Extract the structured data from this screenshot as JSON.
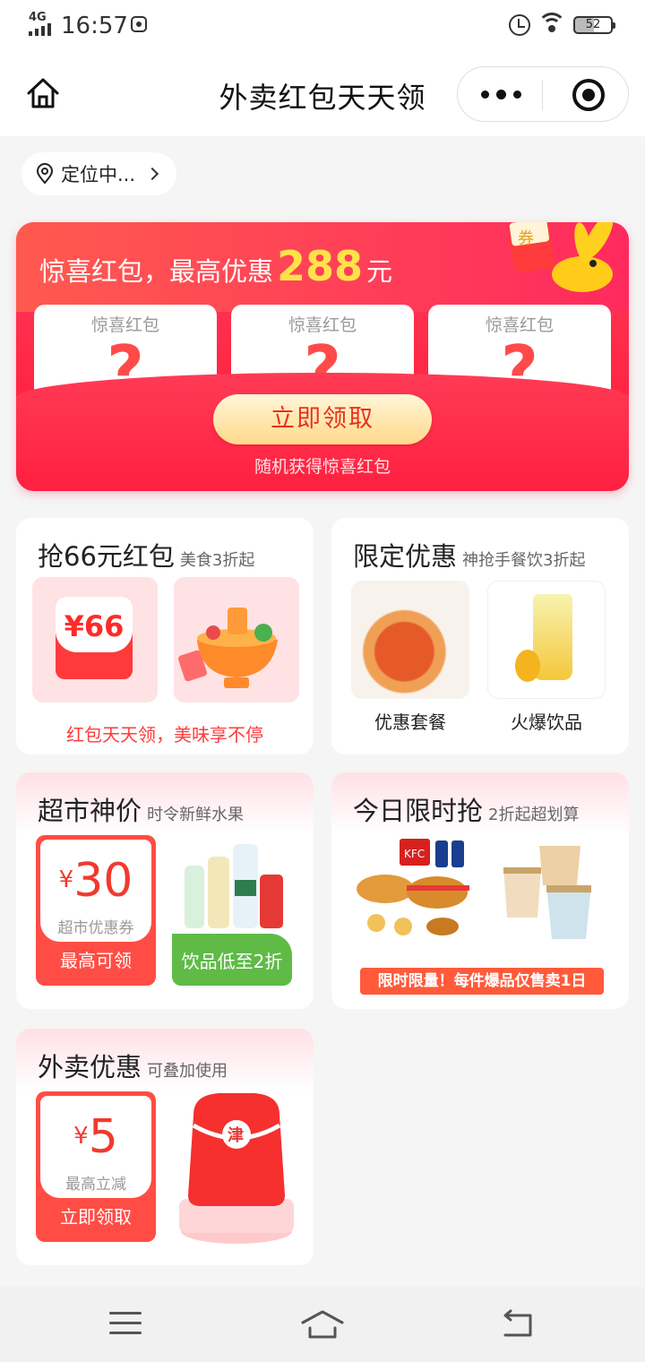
{
  "status_bar": {
    "network": "4G",
    "time": "16:57",
    "battery": "52"
  },
  "nav": {
    "title": "外卖红包天天领",
    "home_icon": "home-icon",
    "more_icon": "more-dots-icon",
    "close_icon": "miniapp-close-icon"
  },
  "location": {
    "label": "定位中..."
  },
  "banner": {
    "title_prefix": "惊喜红包，最高优惠",
    "amount": "288",
    "unit": "元",
    "cards": [
      {
        "label": "惊喜红包",
        "mark": "?"
      },
      {
        "label": "惊喜红包",
        "mark": "?"
      },
      {
        "label": "惊喜红包",
        "mark": "?"
      }
    ],
    "mascot_tag": "券",
    "button": "立即领取",
    "subtitle": "随机获得惊喜红包"
  },
  "sections": {
    "grab": {
      "title": "抢66元红包",
      "subtitle": "美食3折起",
      "badge": "¥66",
      "footer": "红包天天领，美味享不停"
    },
    "limited": {
      "title": "限定优惠",
      "subtitle": "神抢手餐饮3折起",
      "items": [
        "优惠套餐",
        "火爆饮品"
      ]
    },
    "market": {
      "title": "超市神价",
      "subtitle": "时令新鲜水果",
      "coupon_symbol": "¥",
      "coupon_value": "30",
      "coupon_tag": "超市优惠券",
      "coupon_action": "最高可领",
      "promo": "饮品低至2折"
    },
    "flash": {
      "title": "今日限时抢",
      "subtitle": "2折起超划算",
      "brand": "KFC",
      "banner": "限时限量！每件爆品仅售卖1日"
    },
    "delivery": {
      "title": "外卖优惠",
      "subtitle": "可叠加使用",
      "coupon_symbol": "¥",
      "coupon_value": "5",
      "coupon_tag": "最高立减",
      "coupon_action": "立即领取",
      "bag_mark": "津"
    }
  },
  "system_nav": {
    "menu_icon": "menu-icon",
    "home_icon": "home-outline-icon",
    "back_icon": "back-icon"
  },
  "colors": {
    "accent_red": "#ff2644",
    "gold": "#ffe24a",
    "green": "#5fbb46"
  }
}
